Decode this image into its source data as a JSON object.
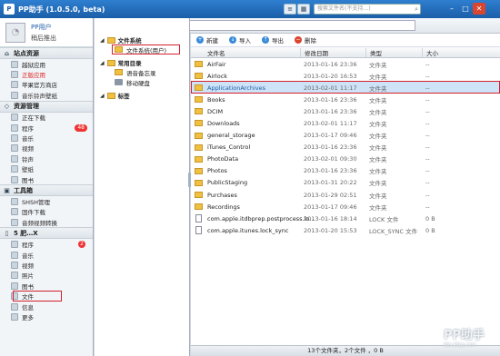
{
  "window": {
    "title": "PP助手 (1.0.5.0, beta)",
    "logo_text": "P",
    "search_placeholder": "搜索文件名(不支持…)"
  },
  "user": {
    "name": "PP用户",
    "logout": "稍后推出"
  },
  "sidebar": {
    "sections": [
      {
        "title": "站点资源",
        "items": [
          {
            "label": "越狱应用"
          },
          {
            "label": "正版应用",
            "red": true
          },
          {
            "label": "苹果官方商店"
          },
          {
            "label": "音乐铃声壁纸"
          }
        ]
      },
      {
        "title": "资源管理",
        "items": [
          {
            "label": "正在下载"
          },
          {
            "label": "程序",
            "badge": "48"
          },
          {
            "label": "音乐"
          },
          {
            "label": "视频"
          },
          {
            "label": "铃声"
          },
          {
            "label": "壁纸"
          },
          {
            "label": "图书"
          }
        ]
      },
      {
        "title": "工具箱",
        "items": [
          {
            "label": "SHSH管理"
          },
          {
            "label": "固件下载"
          },
          {
            "label": "音频视频转换"
          }
        ]
      },
      {
        "title": "5 肥…X",
        "items": [
          {
            "label": "程序",
            "circle": "2"
          },
          {
            "label": "音乐"
          },
          {
            "label": "视频"
          },
          {
            "label": "照片"
          },
          {
            "label": "图书"
          },
          {
            "label": "文件",
            "highlight": true
          },
          {
            "label": "信息"
          },
          {
            "label": "更多"
          }
        ]
      }
    ]
  },
  "nav": {
    "path": "/"
  },
  "tree": {
    "groups": [
      {
        "title": "文件系统",
        "items": [
          {
            "label": "文件系统(用户)",
            "highlight": true
          }
        ]
      },
      {
        "title": "常用目录",
        "items": [
          {
            "label": "语音备忘录",
            "kind": "folder"
          },
          {
            "label": "移动硬盘",
            "kind": "drive"
          }
        ]
      },
      {
        "title": "标签",
        "items": []
      }
    ]
  },
  "toolbar": {
    "new": "新建",
    "import": "导入",
    "export": "导出",
    "delete": "删除"
  },
  "table": {
    "headers": {
      "name": "文件名",
      "time": "修改日期",
      "type": "类型",
      "size": "大小"
    },
    "rows": [
      {
        "name": "AirFair",
        "time": "2013-01-16 23:36",
        "type": "文件夹",
        "size": "--"
      },
      {
        "name": "Airlock",
        "time": "2013-01-20 16:53",
        "type": "文件夹",
        "size": "--"
      },
      {
        "name": "ApplicationArchives",
        "time": "2013-02-01 11:17",
        "type": "文件夹",
        "size": "--",
        "selected": true
      },
      {
        "name": "Books",
        "time": "2013-01-16 23:36",
        "type": "文件夹",
        "size": "--"
      },
      {
        "name": "DCIM",
        "time": "2013-01-16 23:36",
        "type": "文件夹",
        "size": "--"
      },
      {
        "name": "Downloads",
        "time": "2013-02-01 11:17",
        "type": "文件夹",
        "size": "--"
      },
      {
        "name": "general_storage",
        "time": "2013-01-17 09:46",
        "type": "文件夹",
        "size": "--"
      },
      {
        "name": "iTunes_Control",
        "time": "2013-01-16 23:36",
        "type": "文件夹",
        "size": "--"
      },
      {
        "name": "PhotoData",
        "time": "2013-02-01 09:30",
        "type": "文件夹",
        "size": "--"
      },
      {
        "name": "Photos",
        "time": "2013-01-16 23:36",
        "type": "文件夹",
        "size": "--"
      },
      {
        "name": "PublicStaging",
        "time": "2013-01-31 20:22",
        "type": "文件夹",
        "size": "--"
      },
      {
        "name": "Purchases",
        "time": "2013-01-29 02:51",
        "type": "文件夹",
        "size": "--"
      },
      {
        "name": "Recordings",
        "time": "2013-01-17 09:46",
        "type": "文件夹",
        "size": "--"
      },
      {
        "name": "com.apple.itdbprep.postprocess.lo...",
        "time": "2013-01-16 18:14",
        "type": "LOCK 文件",
        "size": "0 B",
        "file": true
      },
      {
        "name": "com.apple.itunes.lock_sync",
        "time": "2013-01-20 15:53",
        "type": "LOCK_SYNC 文件",
        "size": "0 B",
        "file": true
      }
    ]
  },
  "status": "13个文件夹，2个文件 ，0 B",
  "watermark": {
    "main": "PP助手",
    "sub": "bbs.25pp.com"
  },
  "colors": {
    "accent": "#1b5ea8",
    "highlight": "#d21f2b",
    "selected_row": "#cfe3f8"
  }
}
